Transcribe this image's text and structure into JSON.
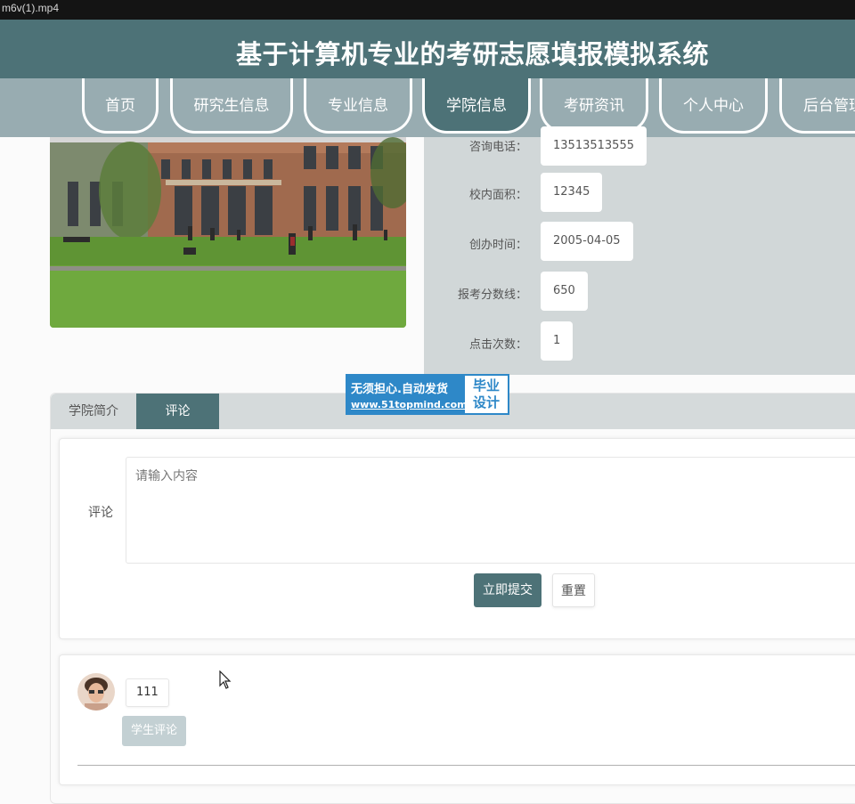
{
  "video_bar": {
    "filename": "m6v(1).mp4"
  },
  "site": {
    "title": "基于计算机专业的考研志愿填报模拟系统"
  },
  "nav": {
    "items": [
      {
        "label": "首页"
      },
      {
        "label": "研究生信息"
      },
      {
        "label": "专业信息"
      },
      {
        "label": "学院信息"
      },
      {
        "label": "考研资讯"
      },
      {
        "label": "个人中心"
      },
      {
        "label": "后台管理"
      }
    ],
    "active_index": 3
  },
  "college_info": {
    "fields": [
      {
        "label": "咨询电话：",
        "value": "13513513555"
      },
      {
        "label": "校内面积：",
        "value": "12345"
      },
      {
        "label": "创办时间：",
        "value": "2005-04-05"
      },
      {
        "label": "报考分数线：",
        "value": "650"
      },
      {
        "label": "点击次数：",
        "value": "1"
      }
    ]
  },
  "watermark": {
    "slogan": "无须担心.自动发货",
    "url": "www.51topmind.com",
    "badge_line1": "毕业",
    "badge_line2": "设计"
  },
  "tabs": [
    {
      "label": "学院简介",
      "active": false
    },
    {
      "label": "评论",
      "active": true
    }
  ],
  "comment_form": {
    "label": "评论",
    "placeholder": "请输入内容",
    "value": "",
    "submit_label": "立即提交",
    "reset_label": "重置"
  },
  "comments": [
    {
      "text": "111",
      "badge": "学生评论"
    }
  ],
  "colors": {
    "primary": "#4d7277",
    "nav_bg": "#98acb1",
    "info_bg": "#d1d7d8",
    "watermark": "#2e88c8"
  }
}
